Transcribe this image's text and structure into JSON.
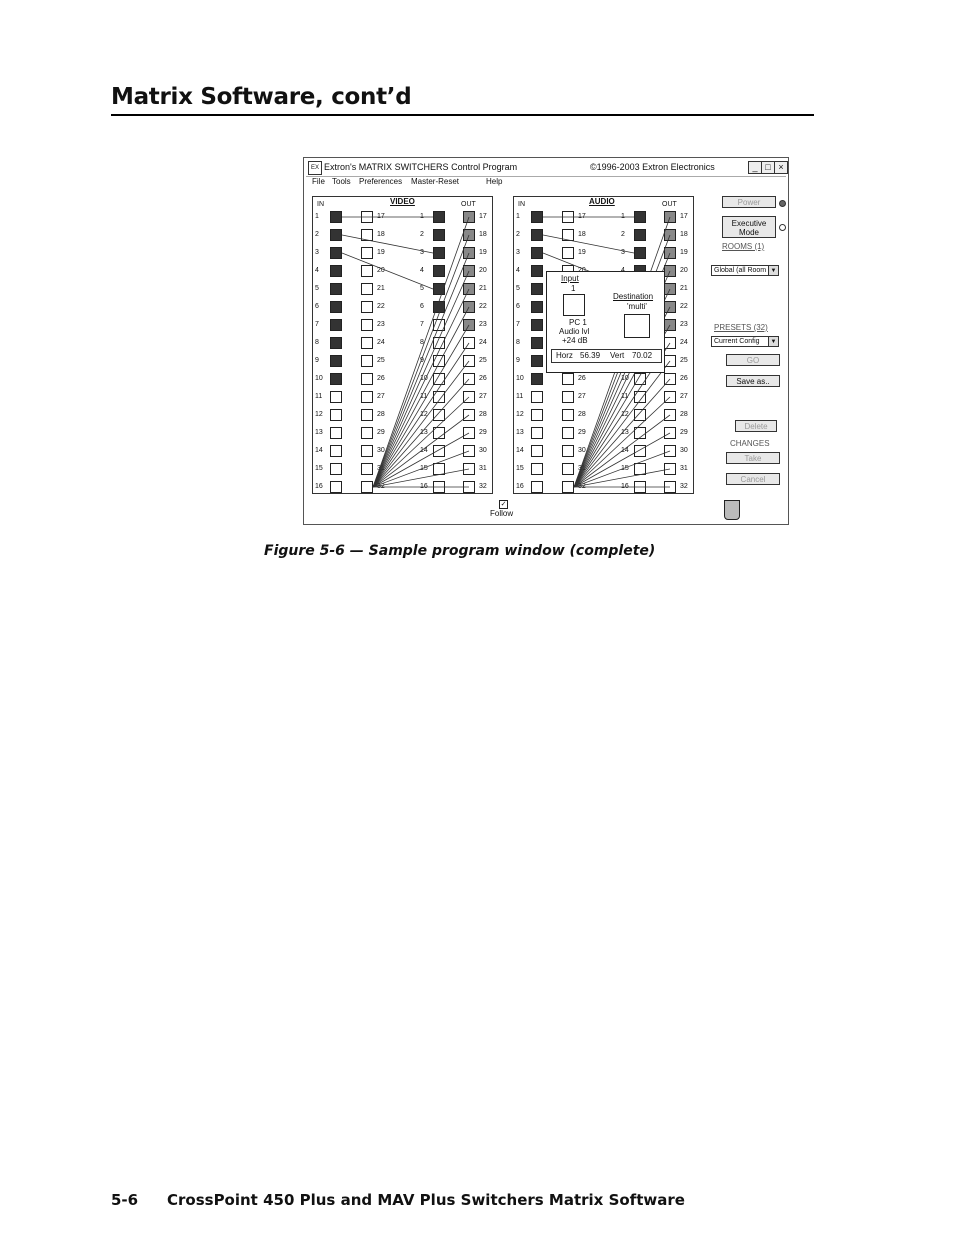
{
  "page": {
    "heading": "Matrix Software, cont’d",
    "caption": "Figure 5-6 — Sample program window (complete)",
    "footer_page": "5-6",
    "footer_text": "CrossPoint 450 Plus and MAV Plus Switchers   Matrix Software"
  },
  "window": {
    "title": "Extron's MATRIX SWITCHERS Control Program",
    "copyright": "©1996-2003 Extron Electronics",
    "min_label": "_",
    "max_label": "□",
    "close_label": "×",
    "menu": [
      "File",
      "Tools",
      "Preferences",
      "Master-Reset",
      "Help"
    ]
  },
  "video_panel": {
    "title": "VIDEO",
    "in_label": "IN",
    "out_label": "OUT"
  },
  "audio_panel": {
    "title": "AUDIO",
    "in_label": "IN",
    "out_label": "OUT"
  },
  "rows": {
    "inputs": [
      "1",
      "2",
      "3",
      "4",
      "5",
      "6",
      "7",
      "8",
      "9",
      "10",
      "11",
      "12",
      "13",
      "14",
      "15",
      "16"
    ],
    "outputs_left": [
      "1",
      "2",
      "3",
      "4",
      "5",
      "6",
      "7",
      "8",
      "9",
      "10",
      "11",
      "12",
      "13",
      "14",
      "15",
      "16"
    ],
    "outputs_right": [
      "17",
      "18",
      "19",
      "20",
      "21",
      "22",
      "23",
      "24",
      "25",
      "26",
      "27",
      "28",
      "29",
      "30",
      "31",
      "32"
    ]
  },
  "side": {
    "power": "Power",
    "executive": "Executive Mode",
    "rooms_label": "ROOMS (1)",
    "rooms_value": "Global (all Room",
    "presets_label": "PRESETS (32)",
    "presets_value": "Current Config",
    "go": "GO",
    "save_as": "Save as..",
    "delete": "Delete",
    "changes": "CHANGES",
    "take": "Take",
    "cancel": "Cancel"
  },
  "popup": {
    "input_label": "Input",
    "input_number": "1",
    "destination_label": "Destination",
    "destination_value": "'multi'",
    "device_name": "PC 1",
    "audio_label": "Audio lvl",
    "audio_value": "+24 dB",
    "horz_label": "Horz",
    "horz_value": "56.39",
    "vert_label": "Vert",
    "vert_value": "70.02"
  },
  "follow_label": "Follow"
}
